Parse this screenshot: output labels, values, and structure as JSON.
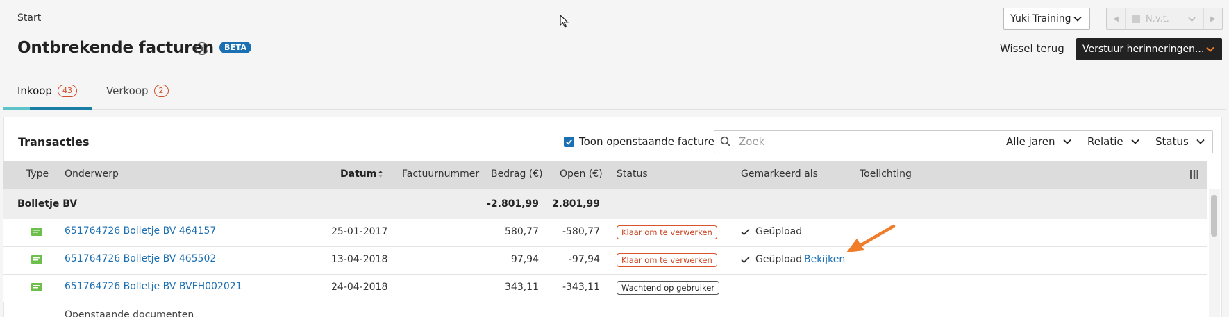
{
  "header": {
    "breadcrumb": "Start",
    "title": "Ontbrekende facturen",
    "beta_badge": "BETA",
    "company_select": "Yuki Training",
    "pager_value": "N.v.t.",
    "switch_back": "Wissel terug",
    "send_reminders": "Verstuur herinneringen..."
  },
  "tabs": [
    {
      "label": "Inkoop",
      "count": "43",
      "active": true
    },
    {
      "label": "Verkoop",
      "count": "2",
      "active": false
    }
  ],
  "panel": {
    "title": "Transacties",
    "show_open_invoices_label": "Toon openstaande facturen",
    "show_open_invoices_checked": true,
    "search_placeholder": "Zoek",
    "filters": {
      "years": "Alle jaren",
      "relation": "Relatie",
      "status": "Status"
    }
  },
  "table": {
    "columns": {
      "type": "Type",
      "subject": "Onderwerp",
      "date": "Datum",
      "invoice_number": "Factuurnummer",
      "amount": "Bedrag (€)",
      "open": "Open (€)",
      "status": "Status",
      "marked_as": "Gemarkeerd als",
      "explanation": "Toelichting"
    },
    "group": {
      "name": "Bolletje BV",
      "amount": "-2.801,99",
      "open": "2.801,99"
    },
    "rows": [
      {
        "subject": "651764726 Bolletje BV 464157",
        "date": "25-01-2017",
        "amount": "580,77",
        "open": "-580,77",
        "status": "Klaar om te verwerken",
        "marked": "Geüpload",
        "action": ""
      },
      {
        "subject": "651764726 Bolletje BV 465502",
        "date": "13-04-2018",
        "amount": "97,94",
        "open": "-97,94",
        "status": "Klaar om te verwerken",
        "marked": "Geüpload",
        "action": "Bekijken"
      },
      {
        "subject": "651764726 Bolletje BV BVFH002021",
        "date": "24-04-2018",
        "amount": "343,11",
        "open": "-343,11",
        "status": "Wachtend op gebruiker",
        "marked": "",
        "action": ""
      }
    ],
    "footer_label": "Openstaande documenten"
  },
  "colors": {
    "accent_blue": "#1b6fb3",
    "status_orange": "#d9532c",
    "annotation_arrow": "#f07d2a",
    "doc_icon_green": "#6cbf4a"
  },
  "icons": [
    "info-icon",
    "chevron-down-icon",
    "search-icon",
    "sort-ascending-icon",
    "columns-icon",
    "document-icon",
    "check-icon",
    "cursor-icon",
    "annotation-arrow"
  ]
}
